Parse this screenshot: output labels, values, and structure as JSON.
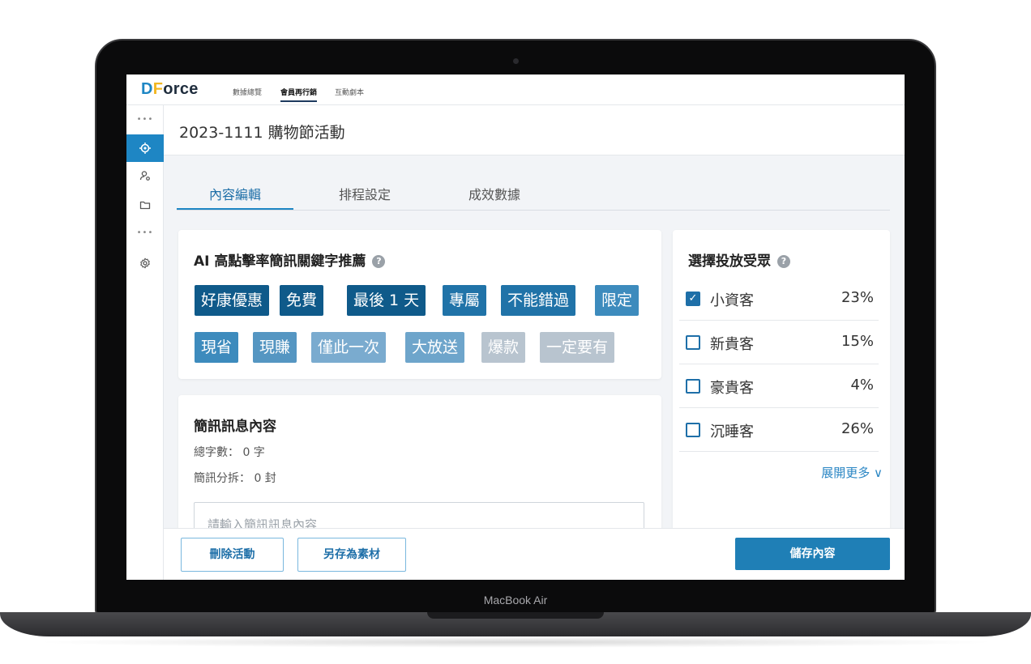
{
  "device_label": "MacBook Air",
  "app": {
    "logo_d": "D",
    "logo_f": "F",
    "logo_rest": "orce"
  },
  "topnav": {
    "tabs": [
      "數據總覽",
      "會員再行銷",
      "互動劇本"
    ],
    "active": "會員再行銷"
  },
  "page": {
    "title": "2023-1111 購物節活動"
  },
  "tabs": {
    "items": [
      "內容編輯",
      "排程設定",
      "成效數據"
    ],
    "active": "內容編輯"
  },
  "keywords": {
    "title": "AI 高點擊率簡訊關鍵字推薦",
    "help": "?",
    "chips": [
      {
        "label": "好康優惠",
        "color": "#0f5a8a"
      },
      {
        "label": "免費",
        "color": "#0f5a8a"
      },
      {
        "label": "最後 1 天",
        "color": "#0f5a8a"
      },
      {
        "label": "專屬",
        "color": "#2073a8"
      },
      {
        "label": "不能錯過",
        "color": "#2073a8"
      },
      {
        "label": "限定",
        "color": "#3d8bbd"
      },
      {
        "label": "現省",
        "color": "#3d8bbd"
      },
      {
        "label": "現賺",
        "color": "#5596c2"
      },
      {
        "label": "僅此一次",
        "color": "#7aabcf"
      },
      {
        "label": "大放送",
        "color": "#6ea5cb"
      },
      {
        "label": "爆款",
        "color": "#b8c4cf"
      },
      {
        "label": "一定要有",
        "color": "#b8c4cf"
      }
    ]
  },
  "audience": {
    "title": "選擇投放受眾",
    "help": "?",
    "rows": [
      {
        "label": "小資客",
        "pct": "23%",
        "checked": true,
        "check_mark": "✓"
      },
      {
        "label": "新貴客",
        "pct": "15%",
        "checked": false,
        "check_mark": ""
      },
      {
        "label": "豪貴客",
        "pct": "4%",
        "checked": false,
        "check_mark": ""
      },
      {
        "label": "沉睡客",
        "pct": "26%",
        "checked": false,
        "check_mark": ""
      }
    ],
    "expand": "展開更多 ∨"
  },
  "sms": {
    "title": "簡訊訊息內容",
    "char_count": "總字數： 0 字",
    "split_count": "簡訊分拆： 0 封",
    "placeholder": "請輸入簡訊訊息內容"
  },
  "footer": {
    "delete_label": "刪除活動",
    "save_as_label": "另存為素材",
    "save_label": "儲存內容"
  }
}
